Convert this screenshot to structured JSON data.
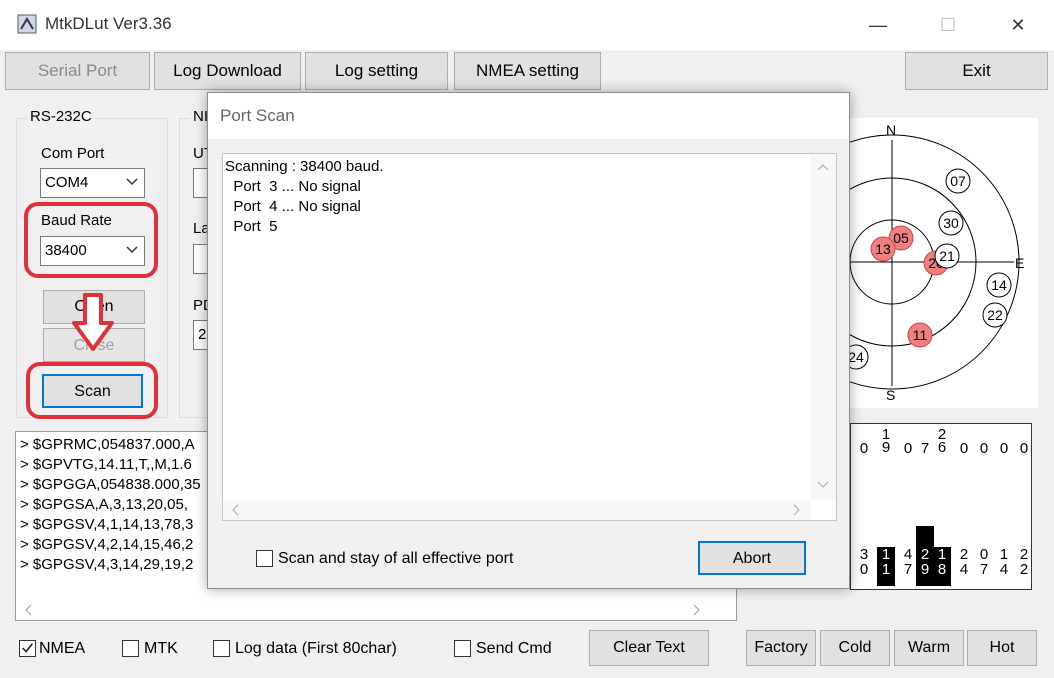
{
  "window": {
    "title": "MtkDLut Ver3.36",
    "min": "—",
    "max": "☐",
    "close": "✕"
  },
  "tabs": [
    {
      "label": "Serial Port",
      "disabled": true
    },
    {
      "label": "Log Download"
    },
    {
      "label": "Log setting"
    },
    {
      "label": "NMEA setting"
    }
  ],
  "exit_label": "Exit",
  "rs232": {
    "group_label": "RS-232C",
    "com_port_label": "Com Port",
    "com_port_value": "COM4",
    "baud_label": "Baud Rate",
    "baud_value": "38400",
    "open_label": "Open",
    "close_label": "Close",
    "scan_label": "Scan"
  },
  "partial_group": {
    "label": "NI",
    "ut_label": "UT",
    "la_label": "La",
    "pd_label": "PD",
    "pd_value": "2"
  },
  "nmea_lines": [
    "> $GPRMC,054837.000,A",
    "> $GPVTG,14.11,T,,M,1.6",
    "> $GPGGA,054838.000,35",
    "> $GPGSA,A,3,13,20,05,",
    "> $GPGSV,4,1,14,13,78,3",
    "> $GPGSV,4,2,14,15,46,2",
    "> $GPGSV,4,3,14,29,19,2"
  ],
  "dialog": {
    "title": "Port Scan",
    "log_lines": [
      "Scanning : 38400 baud.",
      "  Port  3 ... No signal",
      "  Port  4 ... No signal",
      "  Port  5"
    ],
    "checkbox_label": "Scan and stay of all effective port",
    "abort_label": "Abort"
  },
  "bottom": {
    "nmea_label": "NMEA",
    "mtk_label": "MTK",
    "logdata_label": "Log data (First 80char)",
    "sendcmd_label": "Send Cmd",
    "clear_label": "Clear Text",
    "factory_label": "Factory",
    "cold_label": "Cold",
    "warm_label": "Warm",
    "hot_label": "Hot"
  },
  "skyplot": {
    "north": "N",
    "south": "S",
    "east": "E",
    "sats": [
      {
        "id": "07",
        "used": false
      },
      {
        "id": "30",
        "used": false
      },
      {
        "id": "05",
        "used": true
      },
      {
        "id": "13",
        "used": true
      },
      {
        "id": "20",
        "used": true
      },
      {
        "id": "21",
        "used": false
      },
      {
        "id": "14",
        "used": false
      },
      {
        "id": "22",
        "used": false
      },
      {
        "id": "11",
        "used": true
      },
      {
        "id": "24",
        "used": false
      }
    ]
  },
  "snr": {
    "top_digits": [
      "0",
      "19",
      "0",
      "7",
      "26",
      "0",
      "0",
      "0",
      "0"
    ],
    "bars": [
      {
        "id": "30",
        "level": 0
      },
      {
        "id": "11",
        "level": 0.55
      },
      {
        "id": "47",
        "level": 0
      },
      {
        "id": "29",
        "level": 0.85
      },
      {
        "id": "18",
        "level": 0.55
      },
      {
        "id": "24",
        "level": 0
      },
      {
        "id": "07",
        "level": 0
      },
      {
        "id": "14",
        "level": 0
      },
      {
        "id": "22",
        "level": 0
      }
    ]
  },
  "colors": {
    "used_sat": "#f08080",
    "highlight": "#e0303a",
    "accent": "#0078d7"
  }
}
